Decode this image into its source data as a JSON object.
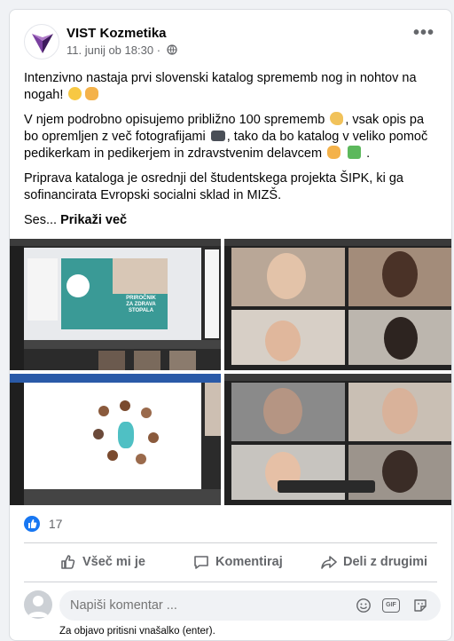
{
  "post": {
    "page_name": "VIST Kozmetika",
    "date": "11. junij ob 18:30",
    "dot": "·",
    "more_label": "•••",
    "paragraphs": [
      "Intenzivno nastaja prvi slovenski katalog sprememb nog in nohtov na nogah!",
      "V njem podrobno opisujemo približno 100 sprememb",
      ", vsak opis pa bo opremljen z več fotografijami",
      ", tako da bo katalog v veliko pomoč pedikerkam in pedikerjem in zdravstvenim delavcem",
      "Priprava kataloga je osrednji del študentskega projekta ŠIPK, ki ga sofinancirata Evropski socialni sklad in MIZŠ."
    ],
    "truncated": "Ses...",
    "see_more": "Prikaži več"
  },
  "photos": {
    "slide_title_line1": "PRIROČNIK",
    "slide_title_line2": "ZA ZDRAVA",
    "slide_title_line3": "STOPALA"
  },
  "stats": {
    "like_count": "17"
  },
  "actions": {
    "like_label": "Všeč mi je",
    "comment_label": "Komentiraj",
    "share_label": "Deli z drugimi"
  },
  "comment": {
    "placeholder": "Napiši komentar ...",
    "hint": "Za objavo pritisni vnašalko (enter).",
    "gif_label": "GIF"
  },
  "colors": {
    "accent": "#1877f2",
    "brand_purple": "#5b2a86",
    "teal": "#3a9a96"
  },
  "icons": {
    "logo": "vist-logo-icon",
    "globe": "globe-icon",
    "like": "thumbs-up-icon",
    "comment": "comment-icon",
    "share": "share-arrow-icon",
    "emoji": "smiley-icon",
    "gif": "gif-icon",
    "sticker": "sticker-icon"
  }
}
